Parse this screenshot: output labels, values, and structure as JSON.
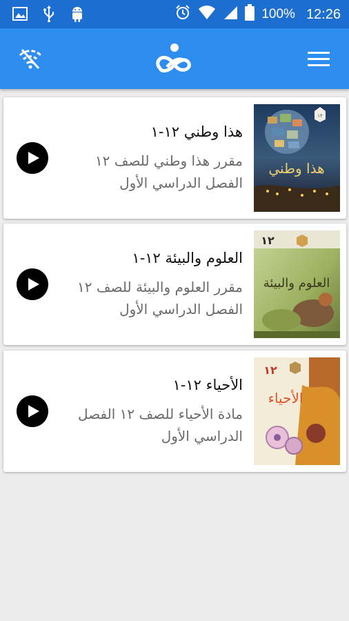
{
  "status_bar": {
    "battery_percent": "100%",
    "time": "12:26",
    "left_icons": [
      "image-icon",
      "usb-icon",
      "android-icon"
    ],
    "right_icons": [
      "alarm-icon",
      "wifi-icon",
      "signal-icon",
      "battery-icon"
    ]
  },
  "app_bar": {
    "left_icon": "wifi-off-icon",
    "logo_icon": "app-logo",
    "right_icon": "menu-icon",
    "color": "#2d8ef0"
  },
  "courses": [
    {
      "title": "هذا وطني ١٢-١",
      "description": "مقرر هذا وطني للصف ١٢ الفصل الدراسي الأول",
      "cover_title": "هذا وطني",
      "grade": "12"
    },
    {
      "title": "العلوم والبيئة ١٢-١",
      "description": "مقرر العلوم والبيئة للصف ١٢ الفصل الدراسي الأول",
      "cover_title": "العلوم والبيئة",
      "grade": "١٢"
    },
    {
      "title": "الأحياء ١٢-١",
      "description": "مادة الأحياء للصف ١٢ الفصل الدراسي الأول",
      "cover_title": "الأحياء",
      "grade": "١٢"
    }
  ]
}
